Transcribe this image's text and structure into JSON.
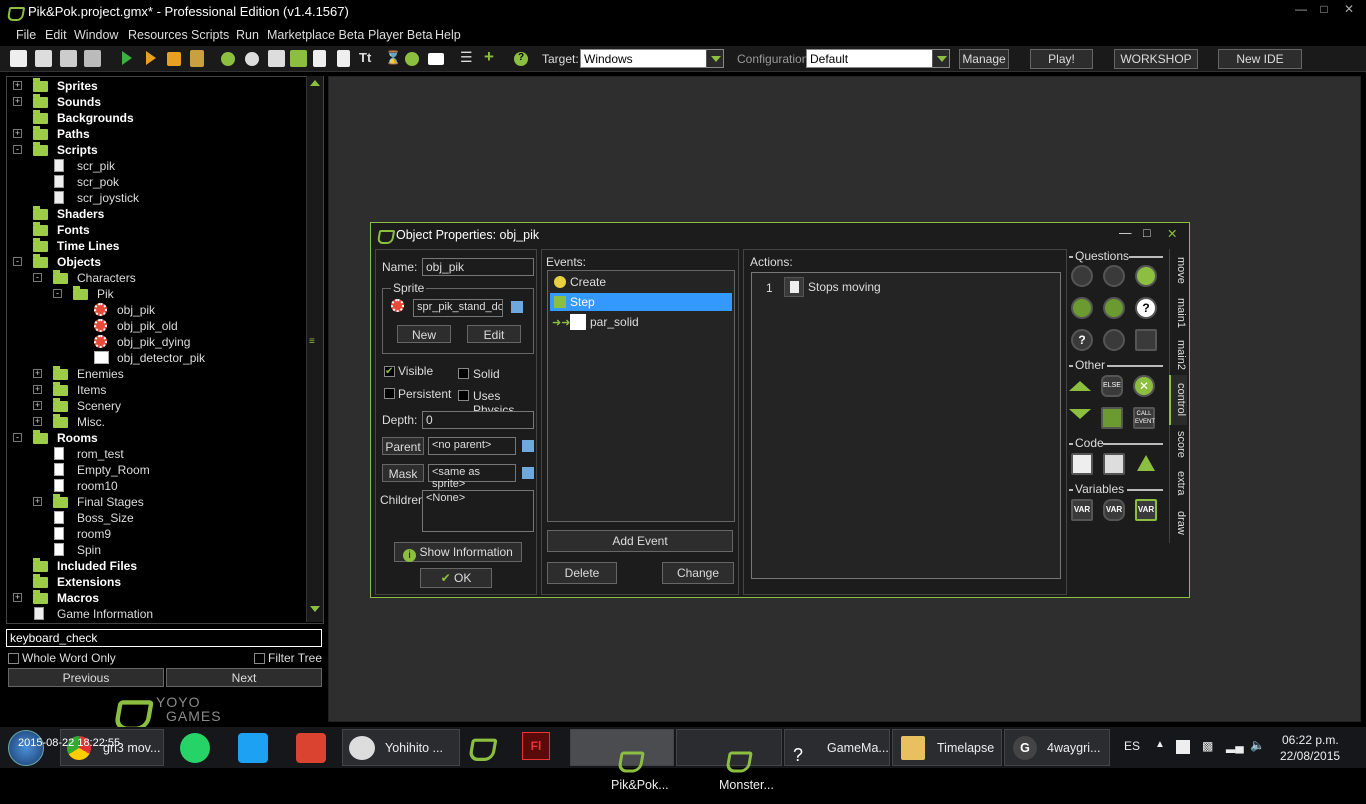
{
  "window": {
    "title": "Pik&Pok.project.gmx*  -  Professional Edition (v1.4.1567)"
  },
  "menu": [
    "File",
    "Edit",
    "Window",
    "Resources",
    "Scripts",
    "Run",
    "Marketplace Beta",
    "Player Beta",
    "Help"
  ],
  "toolbar": {
    "target_label": "Target:",
    "target_value": "Windows",
    "config_label": "Configuration:",
    "config_value": "Default",
    "manage": "Manage",
    "play": "Play!",
    "workshop": "WORKSHOP",
    "new_ide": "New IDE"
  },
  "tree": [
    {
      "label": "Sprites",
      "bold": true,
      "depth": 0,
      "exp": "+",
      "icon": "folder"
    },
    {
      "label": "Sounds",
      "bold": true,
      "depth": 0,
      "exp": "+",
      "icon": "folder"
    },
    {
      "label": "Backgrounds",
      "bold": true,
      "depth": 0,
      "exp": "",
      "icon": "folder"
    },
    {
      "label": "Paths",
      "bold": true,
      "depth": 0,
      "exp": "+",
      "icon": "folder"
    },
    {
      "label": "Scripts",
      "bold": true,
      "depth": 0,
      "exp": "-",
      "icon": "folder"
    },
    {
      "label": "scr_pik",
      "bold": false,
      "depth": 1,
      "exp": "",
      "icon": "script"
    },
    {
      "label": "scr_pok",
      "bold": false,
      "depth": 1,
      "exp": "",
      "icon": "script"
    },
    {
      "label": "scr_joystick",
      "bold": false,
      "depth": 1,
      "exp": "",
      "icon": "script"
    },
    {
      "label": "Shaders",
      "bold": true,
      "depth": 0,
      "exp": "",
      "icon": "folder"
    },
    {
      "label": "Fonts",
      "bold": true,
      "depth": 0,
      "exp": "",
      "icon": "folder"
    },
    {
      "label": "Time Lines",
      "bold": true,
      "depth": 0,
      "exp": "",
      "icon": "folder"
    },
    {
      "label": "Objects",
      "bold": true,
      "depth": 0,
      "exp": "-",
      "icon": "folder"
    },
    {
      "label": "Characters",
      "bold": false,
      "depth": 1,
      "exp": "-",
      "icon": "folder"
    },
    {
      "label": "Pik",
      "bold": false,
      "depth": 2,
      "exp": "-",
      "icon": "folder"
    },
    {
      "label": "obj_pik",
      "bold": false,
      "depth": 3,
      "exp": "",
      "icon": "obj"
    },
    {
      "label": "obj_pik_old",
      "bold": false,
      "depth": 3,
      "exp": "",
      "icon": "obj"
    },
    {
      "label": "obj_pik_dying",
      "bold": false,
      "depth": 3,
      "exp": "",
      "icon": "obj"
    },
    {
      "label": "obj_detector_pik",
      "bold": false,
      "depth": 3,
      "exp": "",
      "icon": "blank"
    },
    {
      "label": "Enemies",
      "bold": false,
      "depth": 1,
      "exp": "+",
      "icon": "folder"
    },
    {
      "label": "Items",
      "bold": false,
      "depth": 1,
      "exp": "+",
      "icon": "folder"
    },
    {
      "label": "Scenery",
      "bold": false,
      "depth": 1,
      "exp": "+",
      "icon": "folder"
    },
    {
      "label": "Misc.",
      "bold": false,
      "depth": 1,
      "exp": "+",
      "icon": "folder"
    },
    {
      "label": "Rooms",
      "bold": true,
      "depth": 0,
      "exp": "-",
      "icon": "folder"
    },
    {
      "label": "rom_test",
      "bold": false,
      "depth": 1,
      "exp": "",
      "icon": "room"
    },
    {
      "label": "Empty_Room",
      "bold": false,
      "depth": 1,
      "exp": "",
      "icon": "room"
    },
    {
      "label": "room10",
      "bold": false,
      "depth": 1,
      "exp": "",
      "icon": "room"
    },
    {
      "label": "Final Stages",
      "bold": false,
      "depth": 1,
      "exp": "+",
      "icon": "folder"
    },
    {
      "label": "Boss_Size",
      "bold": false,
      "depth": 1,
      "exp": "",
      "icon": "room"
    },
    {
      "label": "room9",
      "bold": false,
      "depth": 1,
      "exp": "",
      "icon": "room"
    },
    {
      "label": "Spin",
      "bold": false,
      "depth": 1,
      "exp": "",
      "icon": "room"
    },
    {
      "label": "Included Files",
      "bold": true,
      "depth": 0,
      "exp": "",
      "icon": "folder"
    },
    {
      "label": "Extensions",
      "bold": true,
      "depth": 0,
      "exp": "",
      "icon": "folder"
    },
    {
      "label": "Macros",
      "bold": true,
      "depth": 0,
      "exp": "+",
      "icon": "folder"
    },
    {
      "label": "Game Information",
      "bold": false,
      "depth": 0,
      "exp": "",
      "icon": "info"
    }
  ],
  "search": {
    "value": "keyboard_check",
    "whole_word": "Whole Word Only",
    "filter_tree": "Filter Tree",
    "previous": "Previous",
    "next": "Next"
  },
  "brand": {
    "line1": "YOYO",
    "line2": "GAMES"
  },
  "dialog": {
    "title": "Object Properties: obj_pik",
    "name_label": "Name:",
    "name_value": "obj_pik",
    "sprite_group": "Sprite",
    "sprite_value": "spr_pik_stand_do",
    "new": "New",
    "edit": "Edit",
    "visible": "Visible",
    "solid": "Solid",
    "persistent": "Persistent",
    "uses_physics": "Uses Physics",
    "depth_label": "Depth:",
    "depth_value": "0",
    "parent_btn": "Parent",
    "parent_value": "<no parent>",
    "mask_btn": "Mask",
    "mask_value": "<same as sprite>",
    "children_label": "Children:",
    "children_value": "<None>",
    "show_info": "Show Information",
    "ok": "OK",
    "events_label": "Events:",
    "events": [
      "Create",
      "Step",
      "par_solid"
    ],
    "add_event": "Add Event",
    "delete": "Delete",
    "change": "Change",
    "actions_label": "Actions:",
    "actions": [
      {
        "num": "1",
        "text": "Stops moving"
      }
    ],
    "groups": {
      "questions": "Questions",
      "other": "Other",
      "code": "Code",
      "variables": "Variables"
    },
    "var": "VAR",
    "else": "ELSE",
    "call_event": "CALL EVENT",
    "tabs": [
      "move",
      "main1",
      "main2",
      "control",
      "score",
      "extra",
      "draw"
    ]
  },
  "taskbar": {
    "items": [
      "gri3 mov...",
      "Yohihito ...",
      "Pik&Pok...",
      "Monster...",
      "GameMa...",
      "Timelapse",
      "4waygri..."
    ],
    "lang": "ES",
    "time": "06:22 p.m.",
    "date": "22/08/2015",
    "overlay_date": "2015-08-22 18:22:55"
  }
}
